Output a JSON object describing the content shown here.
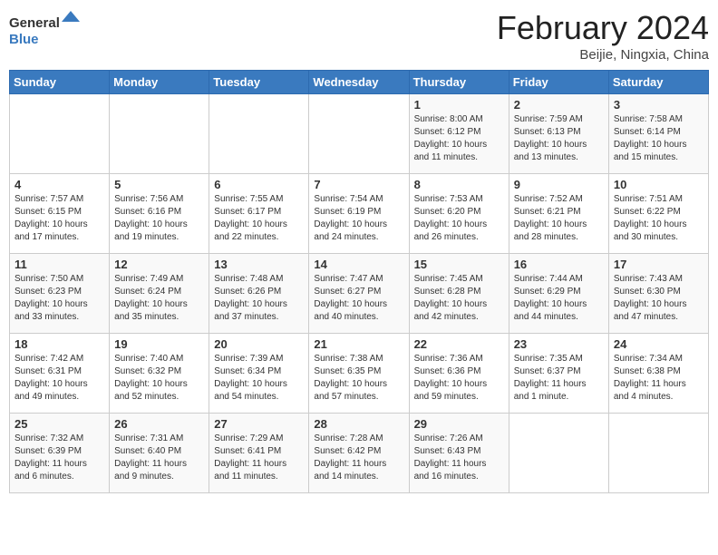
{
  "header": {
    "logo_line1": "General",
    "logo_line2": "Blue",
    "title": "February 2024",
    "subtitle": "Beijie, Ningxia, China"
  },
  "weekdays": [
    "Sunday",
    "Monday",
    "Tuesday",
    "Wednesday",
    "Thursday",
    "Friday",
    "Saturday"
  ],
  "weeks": [
    [
      {
        "day": "",
        "info": ""
      },
      {
        "day": "",
        "info": ""
      },
      {
        "day": "",
        "info": ""
      },
      {
        "day": "",
        "info": ""
      },
      {
        "day": "1",
        "info": "Sunrise: 8:00 AM\nSunset: 6:12 PM\nDaylight: 10 hours\nand 11 minutes."
      },
      {
        "day": "2",
        "info": "Sunrise: 7:59 AM\nSunset: 6:13 PM\nDaylight: 10 hours\nand 13 minutes."
      },
      {
        "day": "3",
        "info": "Sunrise: 7:58 AM\nSunset: 6:14 PM\nDaylight: 10 hours\nand 15 minutes."
      }
    ],
    [
      {
        "day": "4",
        "info": "Sunrise: 7:57 AM\nSunset: 6:15 PM\nDaylight: 10 hours\nand 17 minutes."
      },
      {
        "day": "5",
        "info": "Sunrise: 7:56 AM\nSunset: 6:16 PM\nDaylight: 10 hours\nand 19 minutes."
      },
      {
        "day": "6",
        "info": "Sunrise: 7:55 AM\nSunset: 6:17 PM\nDaylight: 10 hours\nand 22 minutes."
      },
      {
        "day": "7",
        "info": "Sunrise: 7:54 AM\nSunset: 6:19 PM\nDaylight: 10 hours\nand 24 minutes."
      },
      {
        "day": "8",
        "info": "Sunrise: 7:53 AM\nSunset: 6:20 PM\nDaylight: 10 hours\nand 26 minutes."
      },
      {
        "day": "9",
        "info": "Sunrise: 7:52 AM\nSunset: 6:21 PM\nDaylight: 10 hours\nand 28 minutes."
      },
      {
        "day": "10",
        "info": "Sunrise: 7:51 AM\nSunset: 6:22 PM\nDaylight: 10 hours\nand 30 minutes."
      }
    ],
    [
      {
        "day": "11",
        "info": "Sunrise: 7:50 AM\nSunset: 6:23 PM\nDaylight: 10 hours\nand 33 minutes."
      },
      {
        "day": "12",
        "info": "Sunrise: 7:49 AM\nSunset: 6:24 PM\nDaylight: 10 hours\nand 35 minutes."
      },
      {
        "day": "13",
        "info": "Sunrise: 7:48 AM\nSunset: 6:26 PM\nDaylight: 10 hours\nand 37 minutes."
      },
      {
        "day": "14",
        "info": "Sunrise: 7:47 AM\nSunset: 6:27 PM\nDaylight: 10 hours\nand 40 minutes."
      },
      {
        "day": "15",
        "info": "Sunrise: 7:45 AM\nSunset: 6:28 PM\nDaylight: 10 hours\nand 42 minutes."
      },
      {
        "day": "16",
        "info": "Sunrise: 7:44 AM\nSunset: 6:29 PM\nDaylight: 10 hours\nand 44 minutes."
      },
      {
        "day": "17",
        "info": "Sunrise: 7:43 AM\nSunset: 6:30 PM\nDaylight: 10 hours\nand 47 minutes."
      }
    ],
    [
      {
        "day": "18",
        "info": "Sunrise: 7:42 AM\nSunset: 6:31 PM\nDaylight: 10 hours\nand 49 minutes."
      },
      {
        "day": "19",
        "info": "Sunrise: 7:40 AM\nSunset: 6:32 PM\nDaylight: 10 hours\nand 52 minutes."
      },
      {
        "day": "20",
        "info": "Sunrise: 7:39 AM\nSunset: 6:34 PM\nDaylight: 10 hours\nand 54 minutes."
      },
      {
        "day": "21",
        "info": "Sunrise: 7:38 AM\nSunset: 6:35 PM\nDaylight: 10 hours\nand 57 minutes."
      },
      {
        "day": "22",
        "info": "Sunrise: 7:36 AM\nSunset: 6:36 PM\nDaylight: 10 hours\nand 59 minutes."
      },
      {
        "day": "23",
        "info": "Sunrise: 7:35 AM\nSunset: 6:37 PM\nDaylight: 11 hours\nand 1 minute."
      },
      {
        "day": "24",
        "info": "Sunrise: 7:34 AM\nSunset: 6:38 PM\nDaylight: 11 hours\nand 4 minutes."
      }
    ],
    [
      {
        "day": "25",
        "info": "Sunrise: 7:32 AM\nSunset: 6:39 PM\nDaylight: 11 hours\nand 6 minutes."
      },
      {
        "day": "26",
        "info": "Sunrise: 7:31 AM\nSunset: 6:40 PM\nDaylight: 11 hours\nand 9 minutes."
      },
      {
        "day": "27",
        "info": "Sunrise: 7:29 AM\nSunset: 6:41 PM\nDaylight: 11 hours\nand 11 minutes."
      },
      {
        "day": "28",
        "info": "Sunrise: 7:28 AM\nSunset: 6:42 PM\nDaylight: 11 hours\nand 14 minutes."
      },
      {
        "day": "29",
        "info": "Sunrise: 7:26 AM\nSunset: 6:43 PM\nDaylight: 11 hours\nand 16 minutes."
      },
      {
        "day": "",
        "info": ""
      },
      {
        "day": "",
        "info": ""
      }
    ]
  ]
}
